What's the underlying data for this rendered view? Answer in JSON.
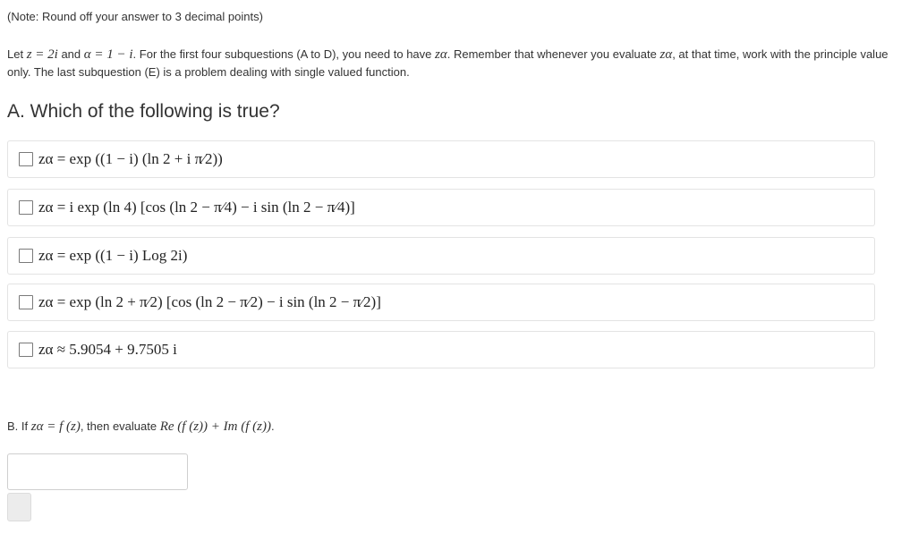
{
  "note": "(Note: Round off your answer to 3 decimal points)",
  "intro": {
    "p1": "Let ",
    "z_eq": "z = 2i",
    "p2": " and ",
    "alpha_eq": "α = 1 − i",
    "p3": ". For the first four subquestions (A to D), you need to have ",
    "za1": "zα",
    "p4": ". Remember that whenever you evaluate ",
    "za2": "zα",
    "p5": ", at that time, work with the principle value only. The last subquestion (E) is a problem dealing with single valued function."
  },
  "question_a": {
    "title": "A. Which of the following is true?",
    "options": [
      {
        "text": "zα = exp ((1 − i) (ln 2 + i π⁄2))"
      },
      {
        "text": "zα = i exp (ln 4) [cos (ln 2 − π⁄4) − i sin (ln 2 − π⁄4)]"
      },
      {
        "text": "zα = exp ((1 − i) Log 2i)"
      },
      {
        "text": "zα = exp (ln 2 + π⁄2) [cos (ln 2 − π⁄2) − i sin (ln 2 − π⁄2)]"
      },
      {
        "text": "zα ≈ 5.9054 + 9.7505 i"
      }
    ]
  },
  "question_b": {
    "p1": "B. If ",
    "math1": "zα = f (z)",
    "p2": ", then evaluate ",
    "math2": "Re (f (z)) + Im (f (z))",
    "p3": "."
  },
  "answer": {
    "value": "",
    "placeholder": ""
  }
}
